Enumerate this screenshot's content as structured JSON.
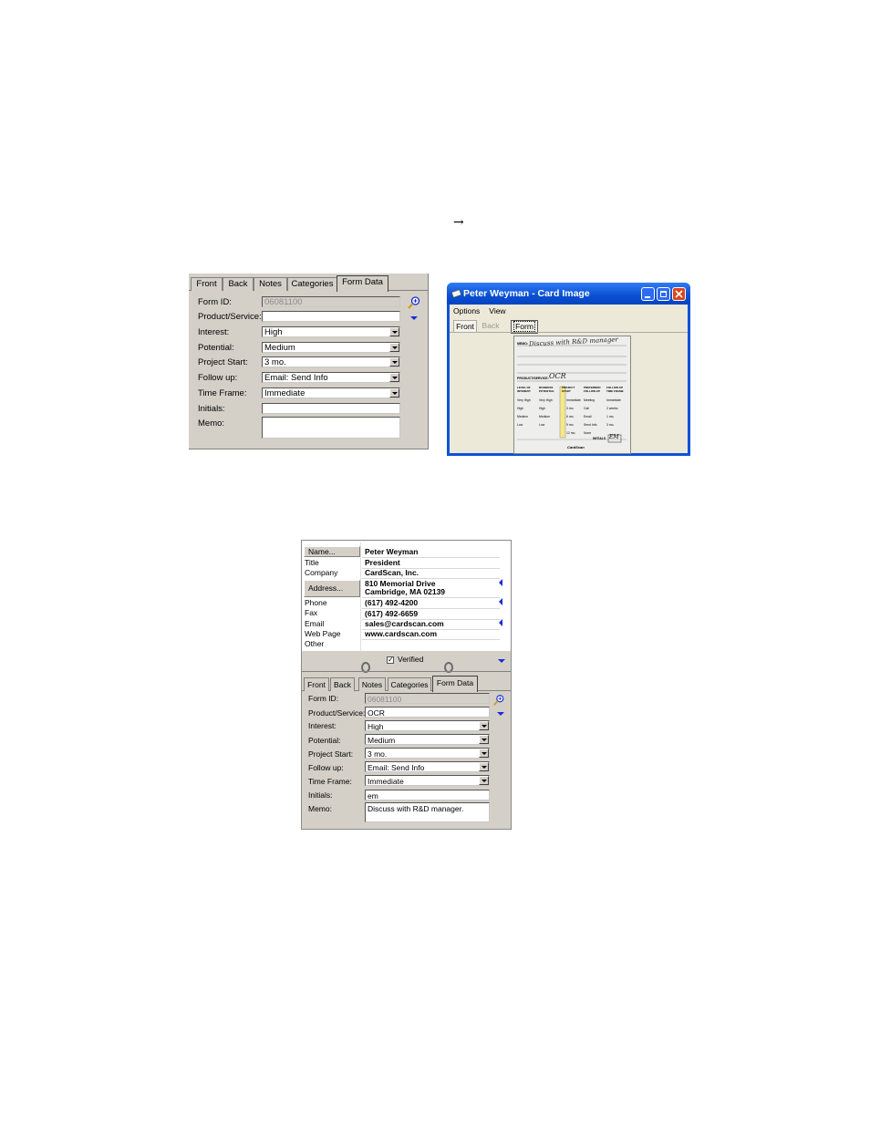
{
  "arrow": "→",
  "formA": {
    "tabs": [
      "Front",
      "Back",
      "Notes",
      "Categories",
      "Form Data"
    ],
    "fields": [
      {
        "label": "Form ID:",
        "value": "06081100",
        "kind": "disabled"
      },
      {
        "label": "Product/Service:",
        "value": "",
        "kind": "text"
      },
      {
        "label": "Interest:",
        "value": "High",
        "kind": "dropdown"
      },
      {
        "label": "Potential:",
        "value": "Medium",
        "kind": "dropdown"
      },
      {
        "label": "Project Start:",
        "value": "3 mo.",
        "kind": "dropdown"
      },
      {
        "label": "Follow up:",
        "value": "Email: Send Info",
        "kind": "dropdown"
      },
      {
        "label": "Time Frame:",
        "value": "Immediate",
        "kind": "dropdown"
      },
      {
        "label": "Initials:",
        "value": "",
        "kind": "text"
      },
      {
        "label": "Memo:",
        "value": "",
        "kind": "memo"
      }
    ]
  },
  "cardWindow": {
    "title": "Peter Weyman - Card Image",
    "menu": [
      "Options",
      "View"
    ],
    "tabs": [
      "Front",
      "Back",
      "Form"
    ],
    "card": {
      "memo": "MEMO:",
      "memo_hand": "Discuss with R&D manager",
      "product_label": "PRODUCT/SERVICE:",
      "product_hand": "OCR",
      "col_heads": [
        "LEVEL OF INTEREST",
        "BUSINESS POTENTIAL",
        "PROJECT START",
        "PREFERRED FOLLOW-UP",
        "FOLLOW-UP TIME FRAME"
      ],
      "col1": [
        "Very High",
        "High",
        "Medium",
        "Low"
      ],
      "col2": [
        "Very High",
        "High",
        "Medium",
        "Low"
      ],
      "col3": [
        "Immediate",
        "3 mo.",
        "6 mo.",
        "9 mo.",
        "12 mo."
      ],
      "col4": [
        "Meeting",
        "Call",
        "Email",
        "Send Info",
        "None"
      ],
      "col5": [
        "Immediate",
        "2 weeks",
        "1 mo.",
        "3 mo."
      ],
      "initials_label": "INITIALS",
      "initials_hand": "EM",
      "brand": "CardScan"
    }
  },
  "contact": {
    "rows": [
      {
        "label": "Name...",
        "value": "Peter Weyman",
        "button": true
      },
      {
        "label": "Title",
        "value": "President",
        "button": false
      },
      {
        "label": "Company",
        "value": "CardScan, Inc.",
        "button": false
      },
      {
        "label": "Address...",
        "value": "810 Memorial Drive",
        "value2": "Cambridge, MA 02139",
        "button": true
      },
      {
        "label": "Phone",
        "value": "(617) 492-4200",
        "button": false
      },
      {
        "label": "Fax",
        "value": "(617) 492-6659",
        "button": false
      },
      {
        "label": "Email",
        "value": "sales@cardscan.com",
        "button": false
      },
      {
        "label": "Web Page",
        "value": "www.cardscan.com",
        "button": false
      },
      {
        "label": "Other",
        "value": "",
        "button": false
      }
    ],
    "verified_label": "Verified",
    "verified_checked": true
  },
  "formC": {
    "tabs": [
      "Front",
      "Back",
      "Notes",
      "Categories",
      "Form Data"
    ],
    "fields": [
      {
        "label": "Form ID:",
        "value": "06081100",
        "kind": "disabled"
      },
      {
        "label": "Product/Service:",
        "value": "OCR",
        "kind": "text"
      },
      {
        "label": "Interest:",
        "value": "High",
        "kind": "dropdown"
      },
      {
        "label": "Potential:",
        "value": "Medium",
        "kind": "dropdown"
      },
      {
        "label": "Project Start:",
        "value": "3 mo.",
        "kind": "dropdown"
      },
      {
        "label": "Follow up:",
        "value": "Email: Send Info",
        "kind": "dropdown"
      },
      {
        "label": "Time Frame:",
        "value": "Immediate",
        "kind": "dropdown"
      },
      {
        "label": "Initials:",
        "value": "em",
        "kind": "text"
      },
      {
        "label": "Memo:",
        "value": "Discuss with R&D manager.",
        "kind": "memo"
      }
    ]
  },
  "colors": {
    "accent": "#1a2bd8",
    "xp_title": "#0a53d8",
    "dialog": "#d4d0c8"
  }
}
